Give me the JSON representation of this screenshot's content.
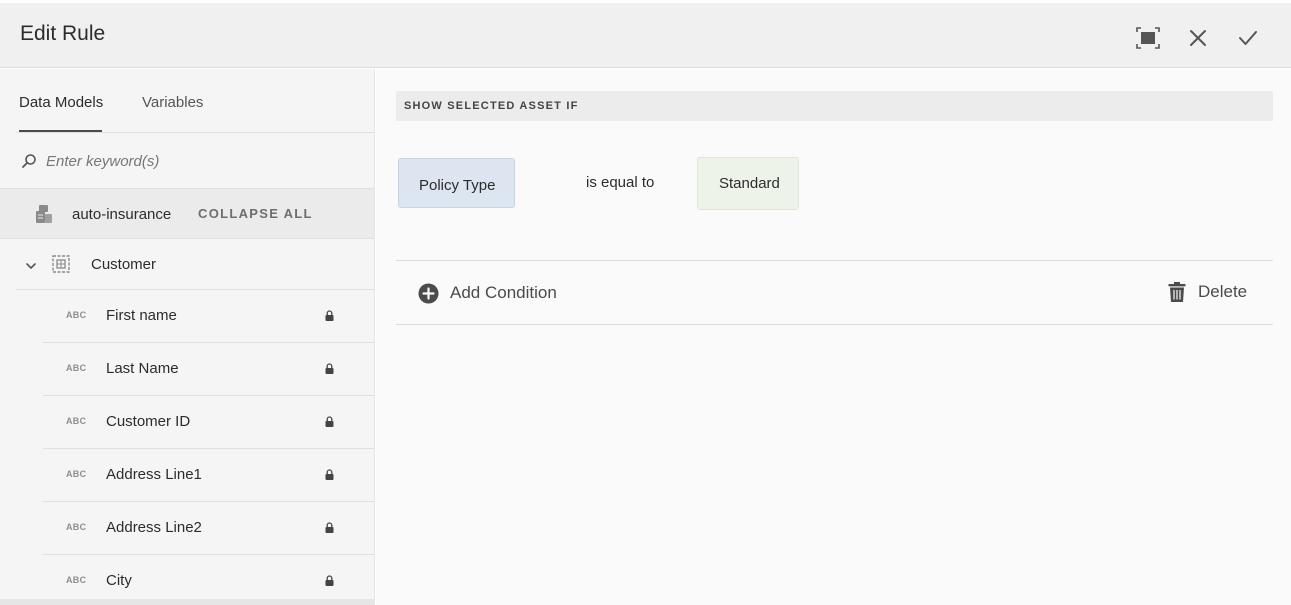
{
  "header": {
    "title": "Edit Rule",
    "fullscreen_icon": "fullscreen-icon",
    "close_icon": "close-icon",
    "done_icon": "checkmark-icon"
  },
  "sidebar": {
    "tabs": [
      {
        "label": "Data Models",
        "active": true
      },
      {
        "label": "Variables",
        "active": false
      }
    ],
    "search": {
      "placeholder": "Enter keyword(s)",
      "value": ""
    },
    "model": {
      "label": "auto-insurance",
      "collapse_label": "COLLAPSE ALL"
    },
    "entity": {
      "label": "Customer",
      "expanded": true
    },
    "fields": [
      {
        "type": "ABC",
        "label": "First name",
        "locked": true
      },
      {
        "type": "ABC",
        "label": "Last Name",
        "locked": true
      },
      {
        "type": "ABC",
        "label": "Customer ID",
        "locked": true
      },
      {
        "type": "ABC",
        "label": "Address Line1",
        "locked": true
      },
      {
        "type": "ABC",
        "label": "Address Line2",
        "locked": true
      },
      {
        "type": "ABC",
        "label": "City",
        "locked": true
      }
    ]
  },
  "rule": {
    "section_title": "SHOW SELECTED ASSET IF",
    "condition": {
      "field": "Policy Type",
      "operator": "is equal to",
      "value": "Standard"
    },
    "add_condition_label": "Add Condition",
    "delete_label": "Delete"
  },
  "colors": {
    "field_chip": "#dde5f0",
    "value_chip": "#eef3ea",
    "header_bg": "#f0f0f0"
  }
}
